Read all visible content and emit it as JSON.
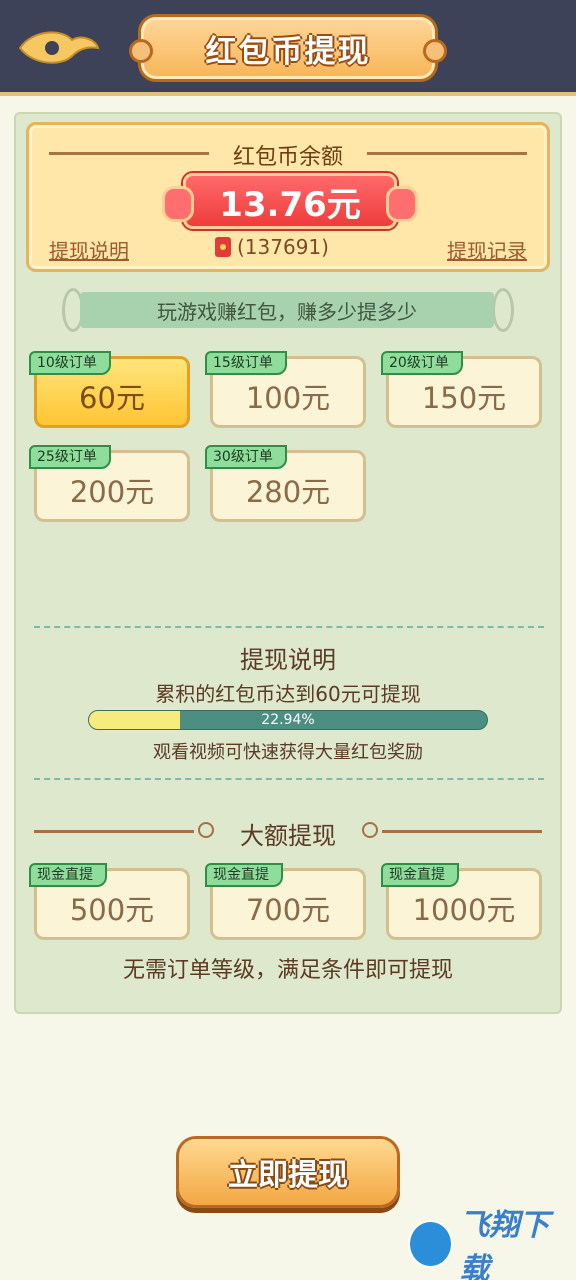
{
  "header": {
    "title": "红包币提现",
    "back_icon": "back-cloud-icon"
  },
  "balance": {
    "label": "红包币余额",
    "amount": "13.76元",
    "explain_link": "提现说明",
    "record_link": "提现记录",
    "coins": "(137691)",
    "coin_icon": "red-packet-icon"
  },
  "banner": {
    "text": "玩游戏赚红包，赚多少提多少"
  },
  "level_options": [
    {
      "tag": "10级订单",
      "value": "60元",
      "selected": true
    },
    {
      "tag": "15级订单",
      "value": "100元",
      "selected": false
    },
    {
      "tag": "20级订单",
      "value": "150元",
      "selected": false
    },
    {
      "tag": "25级订单",
      "value": "200元",
      "selected": false
    },
    {
      "tag": "30级订单",
      "value": "280元",
      "selected": false
    }
  ],
  "explanation": {
    "title": "提现说明",
    "line": "累积的红包币达到60元可提现",
    "progress_value": 0.2294,
    "progress_text": "22.94%",
    "sub": "观看视频可快速获得大量红包奖励"
  },
  "large": {
    "title": "大额提现",
    "options": [
      {
        "tag": "现金直提",
        "value": "500元"
      },
      {
        "tag": "现金直提",
        "value": "700元"
      },
      {
        "tag": "现金直提",
        "value": "1000元"
      }
    ],
    "note": "无需订单等级，满足条件即可提现"
  },
  "action": {
    "label": "立即提现"
  },
  "watermark": {
    "text": "飞翔下载"
  },
  "colors": {
    "header_bg": "#3d4258",
    "accent_orange": "#f6b557",
    "panel_bg": "#dde8cd",
    "amount_red": "#ee3c3c",
    "tag_green": "#8fdd9a",
    "progress_teal": "#4d8e82",
    "progress_fill": "#f6ec7e"
  }
}
